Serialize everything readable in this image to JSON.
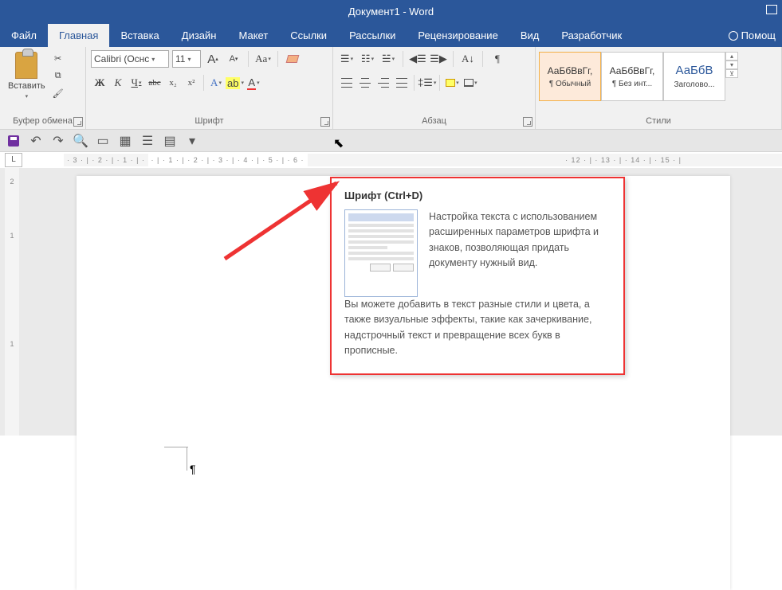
{
  "title": "Документ1 - Word",
  "tabs": {
    "file": "Файл",
    "home": "Главная",
    "insert": "Вставка",
    "design": "Дизайн",
    "layout": "Макет",
    "references": "Ссылки",
    "mailings": "Рассылки",
    "review": "Рецензирование",
    "view": "Вид",
    "developer": "Разработчик",
    "help": "Помощ"
  },
  "clipboard": {
    "paste": "Вставить",
    "label": "Буфер обмена"
  },
  "font": {
    "name": "Calibri (Оснс",
    "size": "11",
    "grow": "A",
    "shrink": "A",
    "case": "Aa",
    "bold": "Ж",
    "italic": "К",
    "underline": "Ч",
    "strike": "abc",
    "sub": "x₂",
    "sup": "x²",
    "effects": "A",
    "highlight": "ab",
    "color": "A",
    "label": "Шрифт"
  },
  "para": {
    "label": "Абзац",
    "sort": "А↓",
    "pilcrow": "¶"
  },
  "styles": {
    "label": "Стили",
    "preview": "АаБбВвГг,",
    "preview_h1": "АаБбВ",
    "normal": "¶ Обычный",
    "nospacing": "¶ Без инт...",
    "heading1": "Заголово..."
  },
  "ruler_l": "L",
  "ruler_h": "· 3 · | · 2 · | · 1 · | · ",
  "ruler_h_active": " · | · 1 · | · 2 · | · 3 · | · 4 · | · 5 · | · 6 ·",
  "ruler_h_tail": "   · 12 · | · 13 · | · 14 · | · 15 · |",
  "ruler_v": [
    "2",
    "",
    "1",
    "",
    "",
    "",
    "1"
  ],
  "cursor": "¶",
  "tooltip": {
    "title": "Шрифт (Ctrl+D)",
    "p1": "Настройка текста с использованием расширенных параметров шрифта и знаков, позволяющая придать документу нужный вид.",
    "p2": "Вы можете добавить в текст разные стили и цвета, а также визуальные эффекты, такие как зачеркивание, надстрочный текст и превращение всех букв в прописные."
  }
}
